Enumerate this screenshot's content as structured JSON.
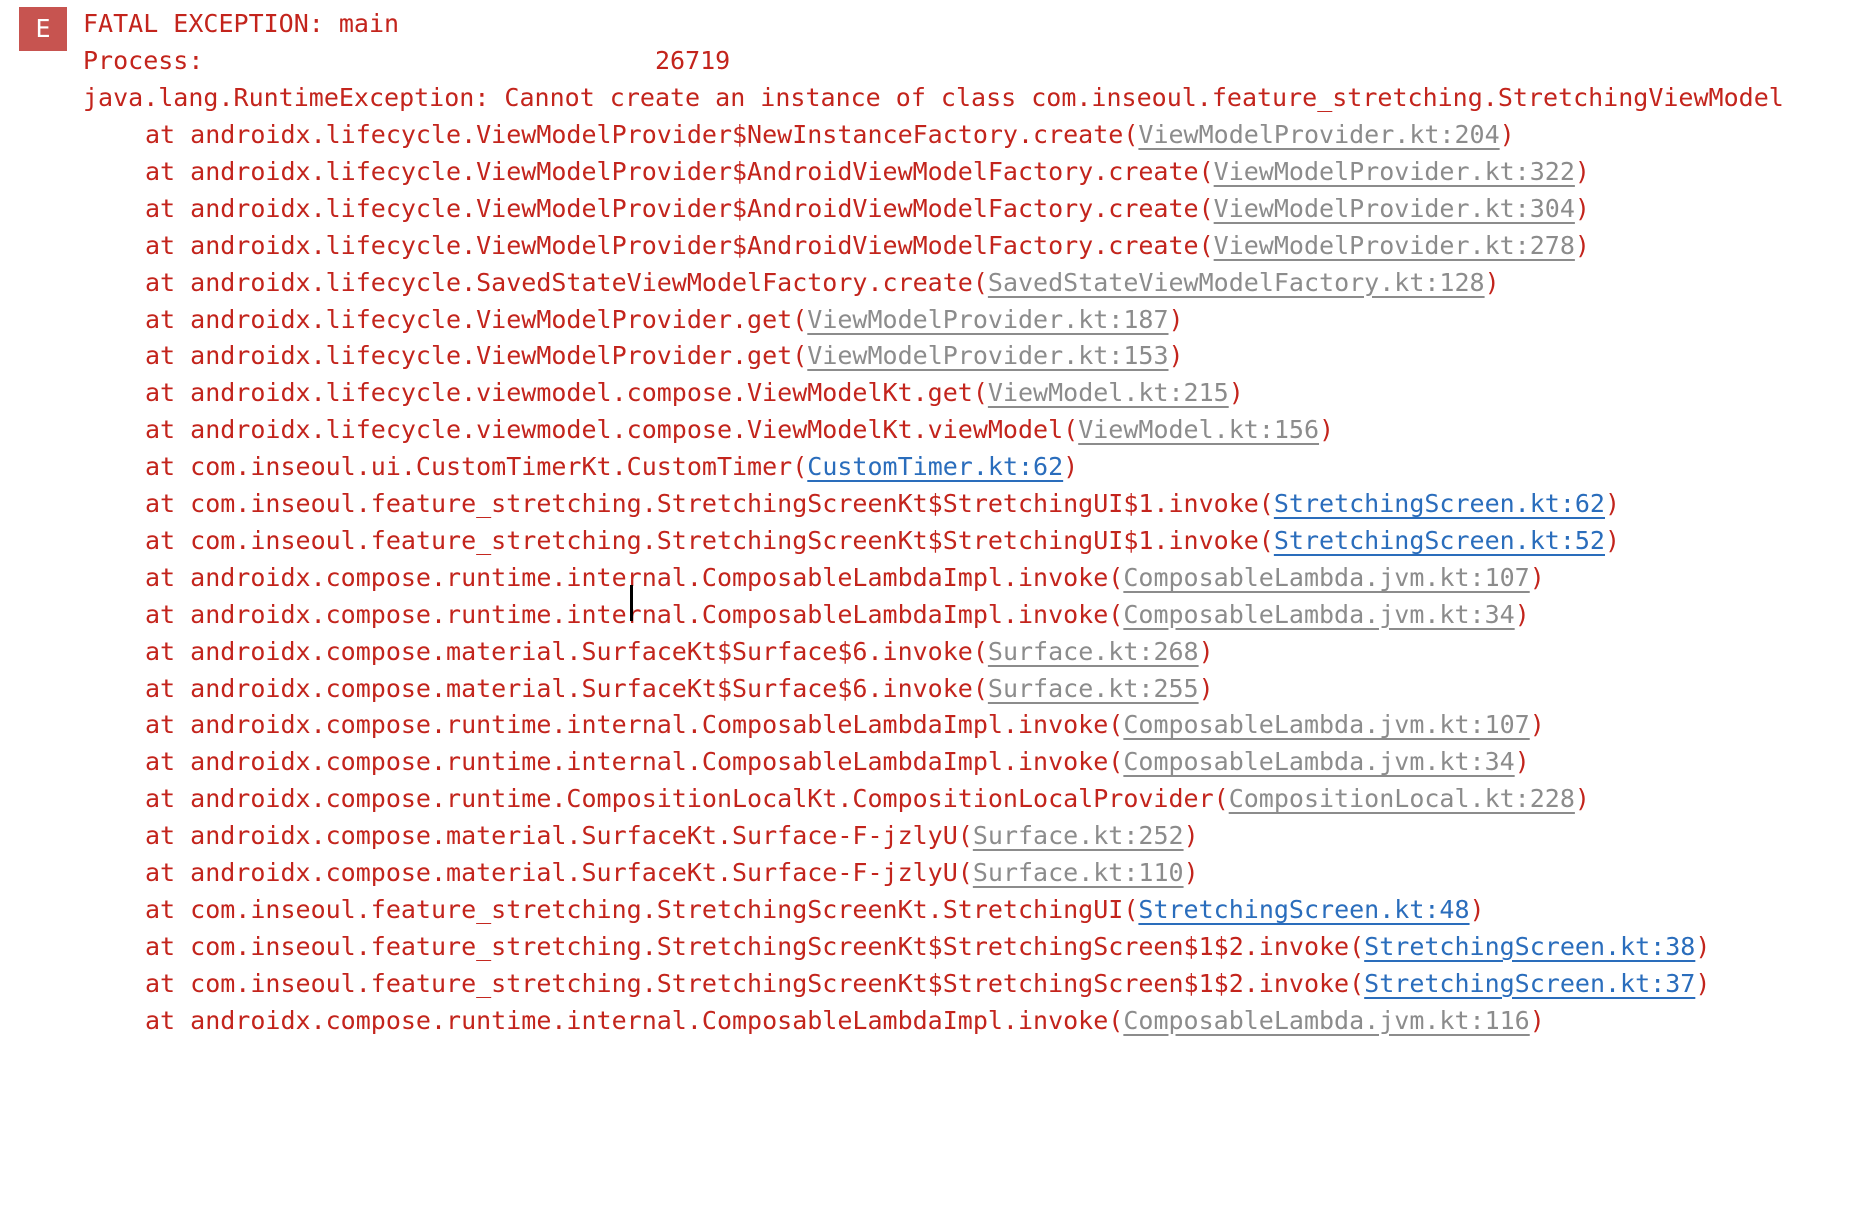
{
  "log": {
    "level_badge": "E",
    "header_line": "FATAL EXCEPTION: main",
    "process_label": "Process:",
    "process_spacing": "                              ",
    "process_id": "26719",
    "exception_line": "java.lang.RuntimeException: Cannot create an instance of class com.inseoul.feature_stretching.StretchingViewModel"
  },
  "stack_frames": [
    {
      "method": "at androidx.lifecycle.ViewModelProvider$NewInstanceFactory.create",
      "source": "ViewModelProvider.kt:204",
      "kind": "library"
    },
    {
      "method": "at androidx.lifecycle.ViewModelProvider$AndroidViewModelFactory.create",
      "source": "ViewModelProvider.kt:322",
      "kind": "library"
    },
    {
      "method": "at androidx.lifecycle.ViewModelProvider$AndroidViewModelFactory.create",
      "source": "ViewModelProvider.kt:304",
      "kind": "library"
    },
    {
      "method": "at androidx.lifecycle.ViewModelProvider$AndroidViewModelFactory.create",
      "source": "ViewModelProvider.kt:278",
      "kind": "library"
    },
    {
      "method": "at androidx.lifecycle.SavedStateViewModelFactory.create",
      "source": "SavedStateViewModelFactory.kt:128",
      "kind": "library"
    },
    {
      "method": "at androidx.lifecycle.ViewModelProvider.get",
      "source": "ViewModelProvider.kt:187",
      "kind": "library"
    },
    {
      "method": "at androidx.lifecycle.ViewModelProvider.get",
      "source": "ViewModelProvider.kt:153",
      "kind": "library"
    },
    {
      "method": "at androidx.lifecycle.viewmodel.compose.ViewModelKt.get",
      "source": "ViewModel.kt:215",
      "kind": "library"
    },
    {
      "method": "at androidx.lifecycle.viewmodel.compose.ViewModelKt.viewModel",
      "source": "ViewModel.kt:156",
      "kind": "library"
    },
    {
      "method": "at com.inseoul.ui.CustomTimerKt.CustomTimer",
      "source": "CustomTimer.kt:62",
      "kind": "project"
    },
    {
      "method": "at com.inseoul.feature_stretching.StretchingScreenKt$StretchingUI$1.invoke",
      "source": "StretchingScreen.kt:62",
      "kind": "project"
    },
    {
      "method": "at com.inseoul.feature_stretching.StretchingScreenKt$StretchingUI$1.invoke",
      "source": "StretchingScreen.kt:52",
      "kind": "project"
    },
    {
      "method": "at androidx.compose.runtime.internal.ComposableLambdaImpl.invoke",
      "source": "ComposableLambda.jvm.kt:107",
      "kind": "library"
    },
    {
      "method": "at androidx.compose.runtime.internal.ComposableLambdaImpl.invoke",
      "source": "ComposableLambda.jvm.kt:34",
      "kind": "library"
    },
    {
      "method": "at androidx.compose.material.SurfaceKt$Surface$6.invoke",
      "source": "Surface.kt:268",
      "kind": "library"
    },
    {
      "method": "at androidx.compose.material.SurfaceKt$Surface$6.invoke",
      "source": "Surface.kt:255",
      "kind": "library"
    },
    {
      "method": "at androidx.compose.runtime.internal.ComposableLambdaImpl.invoke",
      "source": "ComposableLambda.jvm.kt:107",
      "kind": "library"
    },
    {
      "method": "at androidx.compose.runtime.internal.ComposableLambdaImpl.invoke",
      "source": "ComposableLambda.jvm.kt:34",
      "kind": "library"
    },
    {
      "method": "at androidx.compose.runtime.CompositionLocalKt.CompositionLocalProvider",
      "source": "CompositionLocal.kt:228",
      "kind": "library"
    },
    {
      "method": "at androidx.compose.material.SurfaceKt.Surface-F-jzlyU",
      "source": "Surface.kt:252",
      "kind": "library"
    },
    {
      "method": "at androidx.compose.material.SurfaceKt.Surface-F-jzlyU",
      "source": "Surface.kt:110",
      "kind": "library"
    },
    {
      "method": "at com.inseoul.feature_stretching.StretchingScreenKt.StretchingUI",
      "source": "StretchingScreen.kt:48",
      "kind": "project"
    },
    {
      "method": "at com.inseoul.feature_stretching.StretchingScreenKt$StretchingScreen$1$2.invoke",
      "source": "StretchingScreen.kt:38",
      "kind": "project"
    },
    {
      "method": "at com.inseoul.feature_stretching.StretchingScreenKt$StretchingScreen$1$2.invoke",
      "source": "StretchingScreen.kt:37",
      "kind": "project"
    },
    {
      "method": "at androidx.compose.runtime.internal.ComposableLambdaImpl.invoke",
      "source": "ComposableLambda.jvm.kt:116",
      "kind": "library"
    }
  ],
  "colors": {
    "error_text": "#c3241c",
    "badge_bg": "#c75450",
    "library_link": "#8c8c8c",
    "project_link": "#2a6dbc"
  }
}
